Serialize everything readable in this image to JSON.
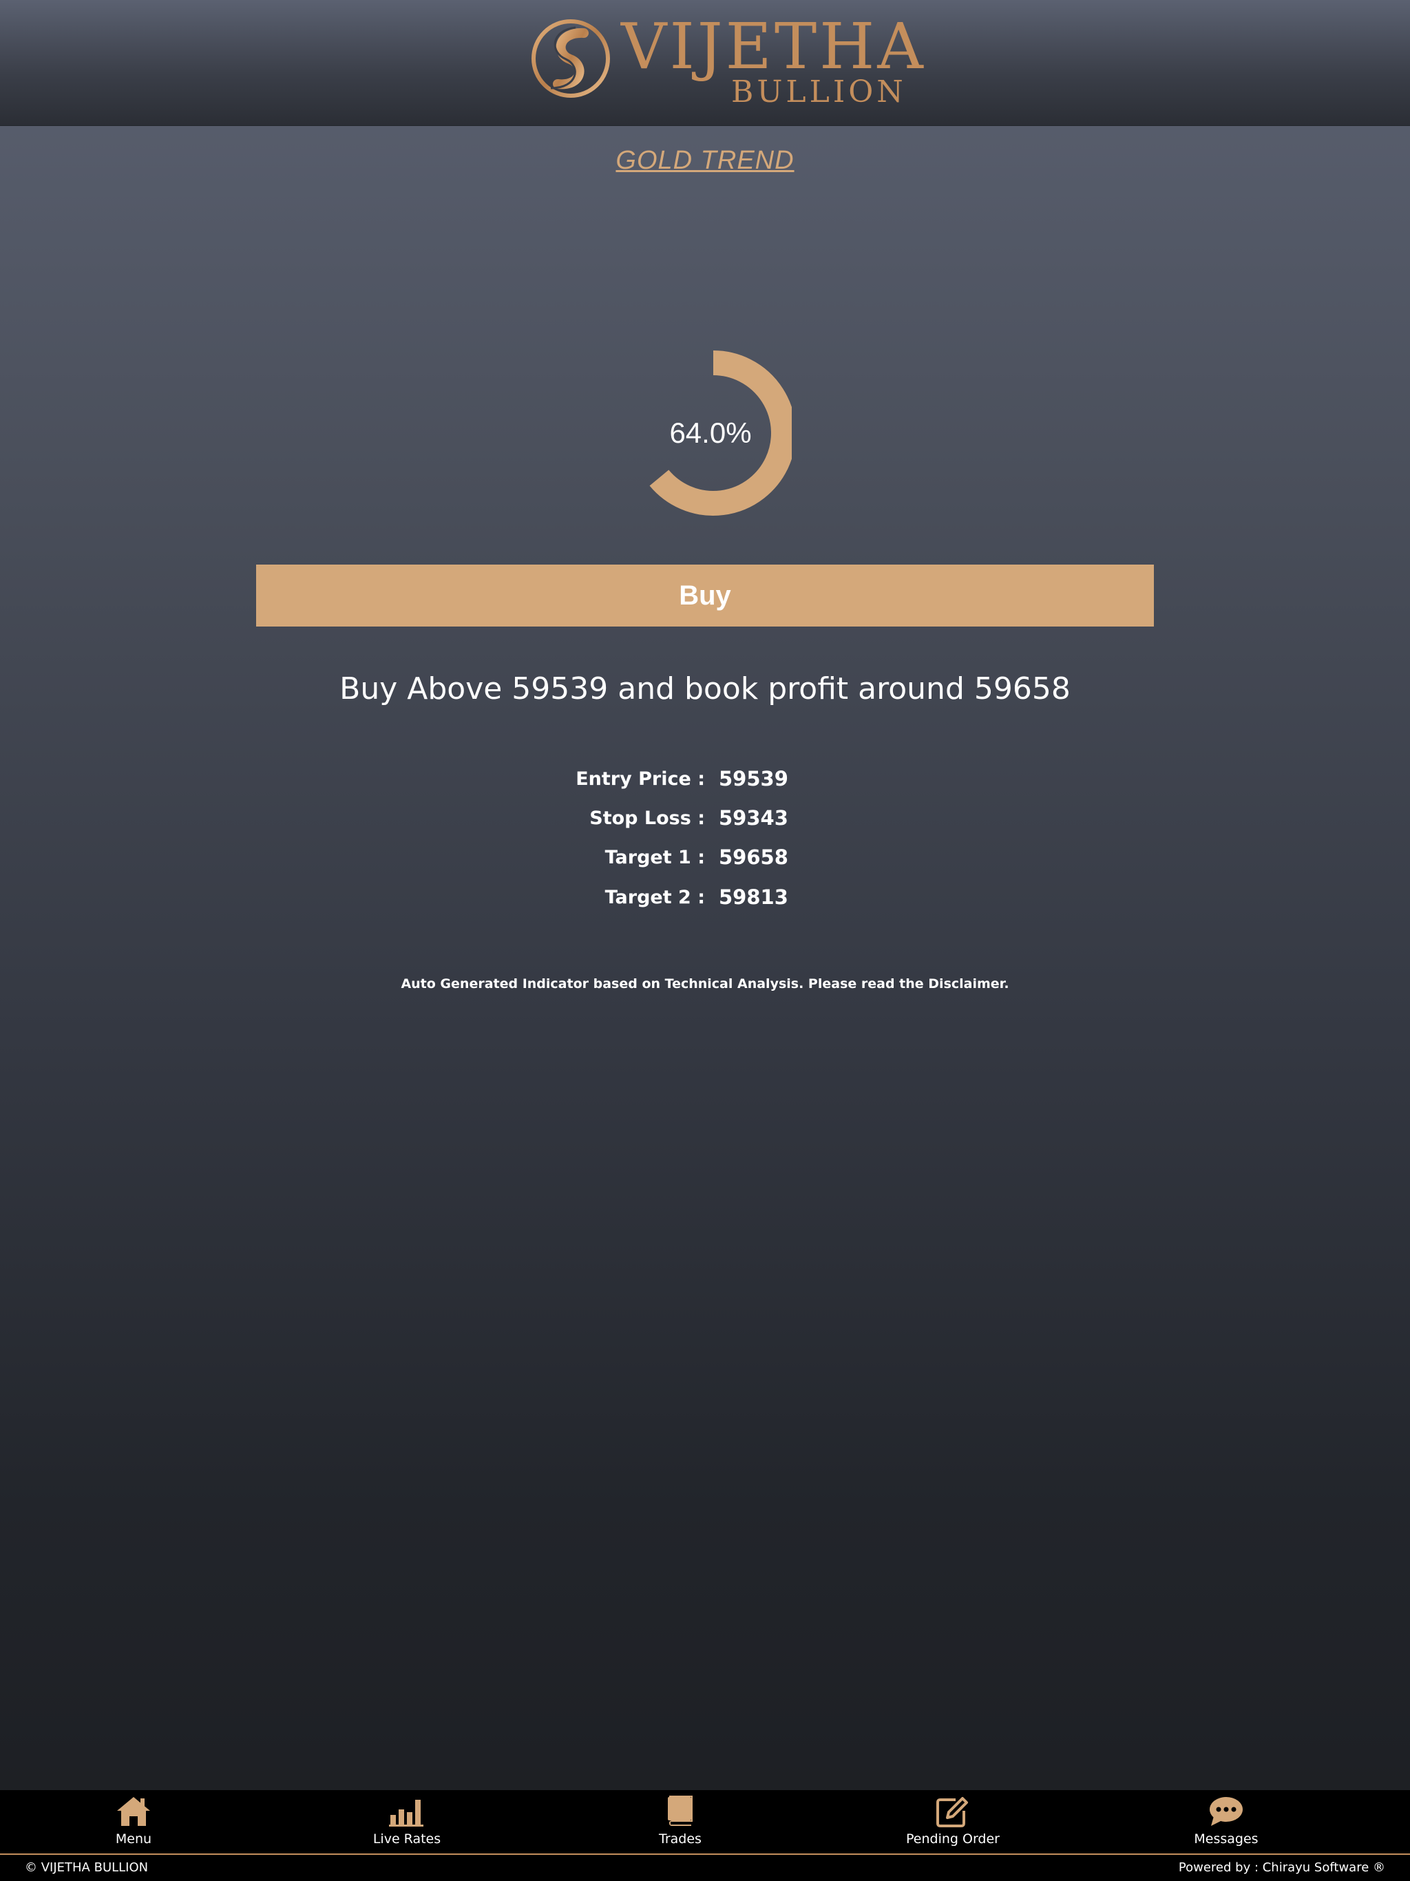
{
  "header": {
    "brand_name": "VIJETHA",
    "brand_sub": "BULLION",
    "brand_color": "#c48e5c"
  },
  "page": {
    "title": "GOLD TREND",
    "title_color": "#d4a87a"
  },
  "trend": {
    "strength_label": "64.0%",
    "strength_value": 64.0,
    "gauge_color": "#d4a87a",
    "signal_label": "Buy",
    "signal_color": "#d4a87a",
    "advice": "Buy Above 59539 and book profit around 59658"
  },
  "levels": [
    {
      "label": "Entry Price :",
      "value": "59539"
    },
    {
      "label": "Stop Loss :",
      "value": "59343"
    },
    {
      "label": "Target 1 :",
      "value": "59658"
    },
    {
      "label": "Target 2 :",
      "value": "59813"
    }
  ],
  "disclaimer": "Auto Generated Indicator based on Technical Analysis. Please read the Disclaimer.",
  "nav": {
    "icon_color": "#d4a87a",
    "items": [
      {
        "label": "Menu",
        "icon": "home-icon"
      },
      {
        "label": "Live Rates",
        "icon": "bar-chart-icon"
      },
      {
        "label": "Trades",
        "icon": "book-icon"
      },
      {
        "label": "Pending Order",
        "icon": "edit-icon"
      },
      {
        "label": "Messages",
        "icon": "chat-icon"
      }
    ]
  },
  "footer": {
    "copyright": "© VIJETHA BULLION",
    "powered_by": "Powered by : Chirayu Software ®"
  }
}
